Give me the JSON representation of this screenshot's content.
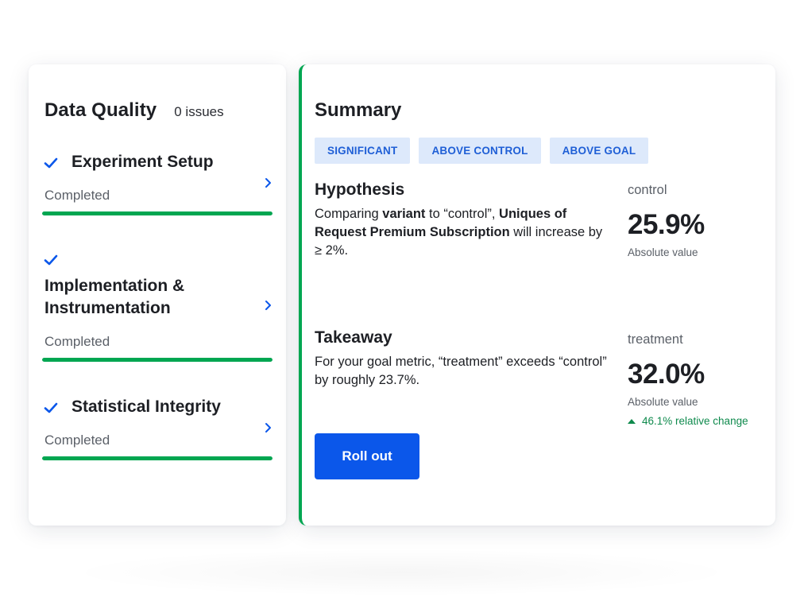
{
  "data_quality": {
    "title": "Data Quality",
    "issues": "0 issues",
    "steps": [
      {
        "title_lines": [
          "Experiment Setup"
        ],
        "status": "Completed",
        "progress_percent": 100
      },
      {
        "title_lines": [
          "Implementation &",
          "Instrumentation"
        ],
        "status": "Completed",
        "progress_percent": 100
      },
      {
        "title_lines": [
          "Statistical Integrity"
        ],
        "status": "Completed",
        "progress_percent": 100
      }
    ]
  },
  "summary": {
    "title": "Summary",
    "tags": [
      "SIGNIFICANT",
      "ABOVE CONTROL",
      "ABOVE GOAL"
    ],
    "hypothesis": {
      "title": "Hypothesis",
      "text_1": "Comparing ",
      "bold_1": "variant",
      "text_2": " to “control”, ",
      "bold_2": "Uniques of Request Premium Subscription",
      "text_3": " will increase by ≥ 2%."
    },
    "takeaway": {
      "title": "Takeaway",
      "text": "For your goal metric, “treatment” exceeds “control” by roughly 23.7%."
    },
    "control": {
      "label": "control",
      "value": "25.9%",
      "sub": "Absolute value"
    },
    "treatment": {
      "label": "treatment",
      "value": "32.0%",
      "sub": "Absolute value",
      "relative_change": "46.1% relative change"
    },
    "rollout_label": "Roll out"
  },
  "colors": {
    "accent_blue": "#0b57ea",
    "success_green": "#00a651",
    "tag_bg": "#dde9fb"
  }
}
